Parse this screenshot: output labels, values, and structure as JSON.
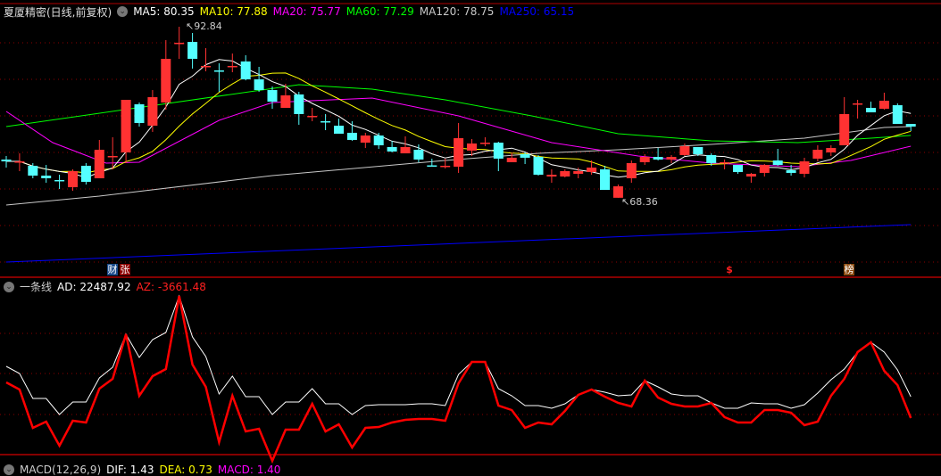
{
  "header": {
    "title": "夏厦精密(日线,前复权)",
    "ma": [
      {
        "label": "MA5: 80.35",
        "color": "#ffffff"
      },
      {
        "label": "MA10: 77.88",
        "color": "#ffff00"
      },
      {
        "label": "MA20: 75.77",
        "color": "#ff00ff"
      },
      {
        "label": "MA60: 77.29",
        "color": "#00ff00"
      },
      {
        "label": "MA120: 78.75",
        "color": "#c8c8c8"
      },
      {
        "label": "MA250: 65.15",
        "color": "#0000ff"
      }
    ]
  },
  "annotations": {
    "high": "92.84",
    "low": "68.36"
  },
  "markers": {
    "cai": "财",
    "zhang": "张",
    "dollar": "$",
    "bang": "榜"
  },
  "indicator": {
    "name": "一条线",
    "ad": "AD: 22487.92",
    "az": "AZ: -3661.48"
  },
  "macd": {
    "name": "MACD(12,26,9)",
    "dif": "DIF: 1.43",
    "dea": "DEA: 0.73",
    "macd": "MACD: 1.40"
  },
  "colors": {
    "up": "#ff3232",
    "down": "#54ffff",
    "grid": "#8b0000",
    "separator": "#b00000"
  },
  "chart_data": {
    "type": "candlestick",
    "candles_ohlc": [
      [
        73.83,
        74.34,
        72.68,
        73.57
      ],
      [
        73.45,
        74.72,
        72.17,
        73.57
      ],
      [
        72.94,
        73.32,
        71.15,
        71.53
      ],
      [
        71.53,
        73.06,
        70.51,
        71.15
      ],
      [
        70.9,
        71.66,
        69.62,
        70.77
      ],
      [
        69.87,
        72.43,
        69.36,
        72.17
      ],
      [
        72.94,
        73.32,
        70.26,
        70.64
      ],
      [
        71.15,
        76.64,
        71.15,
        75.23
      ],
      [
        74.21,
        77.02,
        72.43,
        74.34
      ],
      [
        74.85,
        82.38,
        73.32,
        82.38
      ],
      [
        81.74,
        81.99,
        78.55,
        79.06
      ],
      [
        78.68,
        83.78,
        77.79,
        82.76
      ],
      [
        81.99,
        90.93,
        80.97,
        88.25
      ],
      [
        90.42,
        92.84,
        88.25,
        90.55
      ],
      [
        90.67,
        91.95,
        86.85,
        88.25
      ],
      [
        87.1,
        89.78,
        86.46,
        87.23
      ],
      [
        86.59,
        87.61,
        83.53,
        86.46
      ],
      [
        87.1,
        89.01,
        86.33,
        87.23
      ],
      [
        87.87,
        88.76,
        85.17,
        85.31
      ],
      [
        85.31,
        87.1,
        83.53,
        83.78
      ],
      [
        83.78,
        84.29,
        81.1,
        82.12
      ],
      [
        81.23,
        84.68,
        81.23,
        83.02
      ],
      [
        83.15,
        83.53,
        78.81,
        80.34
      ],
      [
        79.95,
        81.23,
        79.32,
        80.08
      ],
      [
        79.32,
        80.34,
        78.04,
        79.2
      ],
      [
        78.68,
        79.7,
        77.53,
        77.53
      ],
      [
        77.66,
        79.32,
        76.51,
        76.64
      ],
      [
        76.25,
        77.66,
        75.49,
        77.27
      ],
      [
        77.27,
        77.66,
        75.36,
        75.87
      ],
      [
        75.62,
        76.51,
        74.85,
        74.98
      ],
      [
        74.72,
        77.15,
        74.72,
        75.62
      ],
      [
        75.23,
        76.0,
        73.45,
        73.83
      ],
      [
        73.0,
        73.96,
        72.81,
        72.94
      ],
      [
        72.81,
        73.96,
        72.55,
        72.94
      ],
      [
        72.81,
        79.06,
        71.92,
        76.89
      ],
      [
        75.11,
        76.76,
        74.34,
        76.13
      ],
      [
        76.13,
        77.02,
        75.74,
        76.25
      ],
      [
        76.25,
        76.38,
        72.17,
        73.96
      ],
      [
        73.45,
        74.85,
        73.45,
        74.09
      ],
      [
        74.6,
        74.85,
        73.19,
        74.09
      ],
      [
        74.21,
        74.47,
        71.53,
        71.66
      ],
      [
        71.4,
        72.43,
        70.51,
        71.66
      ],
      [
        71.4,
        72.43,
        71.28,
        72.17
      ],
      [
        71.79,
        72.68,
        71.15,
        72.17
      ],
      [
        72.04,
        73.7,
        71.66,
        72.68
      ],
      [
        72.43,
        72.94,
        69.49,
        69.49
      ],
      [
        68.36,
        70.26,
        68.36,
        70.0
      ],
      [
        71.15,
        73.7,
        70.51,
        73.32
      ],
      [
        73.45,
        74.6,
        73.06,
        74.21
      ],
      [
        74.21,
        75.49,
        73.7,
        73.83
      ],
      [
        73.83,
        74.47,
        73.32,
        74.21
      ],
      [
        74.47,
        76.13,
        74.34,
        75.74
      ],
      [
        75.62,
        75.62,
        74.34,
        74.6
      ],
      [
        74.47,
        74.72,
        72.94,
        73.32
      ],
      [
        73.32,
        73.83,
        72.43,
        73.45
      ],
      [
        73.06,
        73.06,
        71.79,
        72.04
      ],
      [
        71.4,
        71.92,
        70.51,
        71.79
      ],
      [
        71.92,
        73.19,
        71.4,
        73.06
      ],
      [
        73.7,
        75.36,
        72.94,
        73.06
      ],
      [
        72.3,
        73.06,
        71.53,
        71.92
      ],
      [
        71.79,
        74.09,
        71.28,
        73.57
      ],
      [
        73.96,
        75.87,
        73.57,
        75.23
      ],
      [
        74.85,
        75.87,
        74.34,
        75.49
      ],
      [
        75.87,
        82.76,
        75.87,
        80.34
      ],
      [
        81.74,
        82.38,
        79.7,
        81.87
      ],
      [
        81.23,
        82.12,
        80.59,
        80.59
      ],
      [
        81.1,
        83.4,
        80.97,
        82.25
      ],
      [
        81.61,
        81.87,
        78.93,
        78.93
      ],
      [
        78.93,
        78.93,
        77.91,
        78.55
      ]
    ],
    "ma_series": {
      "MA20": [
        [
          0,
          80.72
        ],
        [
          3.5,
          76.25
        ],
        [
          7.5,
          73.32
        ],
        [
          10,
          73.45
        ],
        [
          16,
          79.44
        ],
        [
          20,
          81.99
        ],
        [
          27.5,
          82.63
        ],
        [
          34,
          80.08
        ],
        [
          41,
          76.25
        ],
        [
          47.5,
          74.34
        ],
        [
          53,
          73.32
        ],
        [
          59.5,
          72.81
        ],
        [
          63.5,
          73.7
        ],
        [
          68,
          75.74
        ]
      ],
      "MA60": [
        [
          0,
          78.55
        ],
        [
          22,
          84.55
        ],
        [
          27.5,
          83.91
        ],
        [
          33,
          82.38
        ],
        [
          39.5,
          80.08
        ],
        [
          46,
          77.53
        ],
        [
          53,
          76.51
        ],
        [
          59.5,
          76.25
        ],
        [
          65,
          76.89
        ],
        [
          68,
          77.29
        ]
      ],
      "MA120": [
        [
          0,
          67.32
        ],
        [
          7,
          68.6
        ],
        [
          20,
          71.53
        ],
        [
          33,
          73.7
        ],
        [
          40,
          74.72
        ],
        [
          46,
          75.23
        ],
        [
          53,
          76.0
        ],
        [
          60,
          76.89
        ],
        [
          66,
          78.42
        ],
        [
          68,
          78.55
        ]
      ],
      "MA250": [
        [
          0,
          59.16
        ],
        [
          68,
          64.51
        ]
      ]
    },
    "indicator_series": {
      "AD": [
        109,
        101,
        73,
        73,
        55,
        69,
        69,
        96,
        108,
        145,
        119,
        139,
        147,
        188,
        142,
        120,
        78,
        98,
        75,
        75,
        55,
        69,
        69,
        84,
        67,
        67,
        55,
        65,
        66,
        66,
        66,
        67,
        67,
        65,
        100,
        114,
        114,
        84,
        76,
        65,
        65,
        62,
        67,
        77,
        83,
        80,
        76,
        77,
        93,
        86,
        78,
        76,
        76,
        68,
        62,
        62,
        68,
        67,
        67,
        62,
        66,
        79,
        94,
        106,
        125,
        136,
        125,
        105,
        75
      ],
      "AZ": [
        91,
        83,
        40,
        47,
        20,
        48,
        46,
        84,
        95,
        145,
        76,
        98,
        106,
        188,
        111,
        86,
        24,
        76,
        36,
        39,
        3,
        38,
        38,
        67,
        36,
        44,
        18,
        40,
        41,
        46,
        49,
        50,
        50,
        48,
        90,
        114,
        114,
        65,
        60,
        40,
        46,
        44,
        59,
        77,
        83,
        75,
        68,
        64,
        93,
        74,
        67,
        64,
        64,
        68,
        52,
        46,
        46,
        60,
        60,
        57,
        43,
        47,
        76,
        95,
        125,
        136,
        104,
        88,
        51
      ]
    }
  }
}
